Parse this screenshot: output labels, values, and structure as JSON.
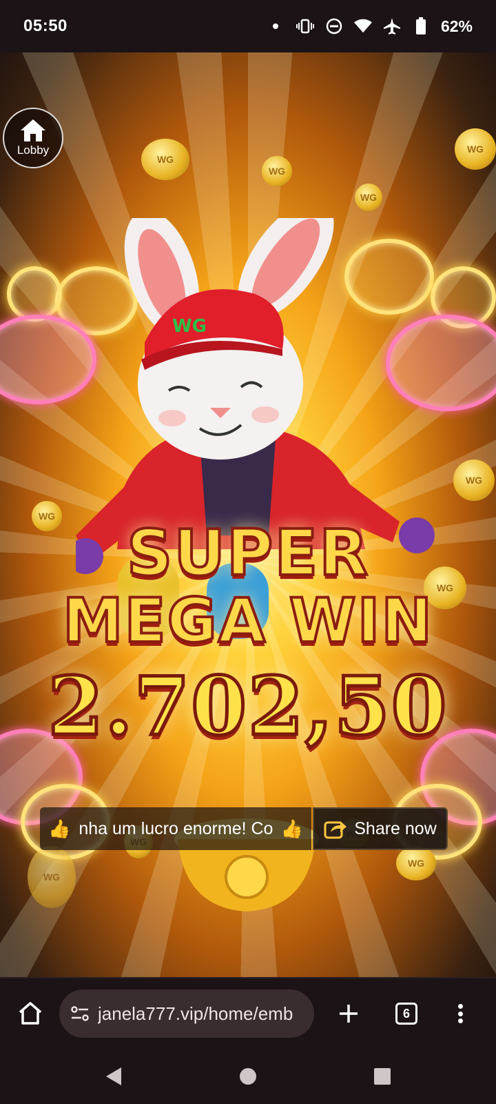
{
  "status_bar": {
    "time": "05:50",
    "battery": "62%",
    "icons": [
      "notification-dot-icon",
      "vibrate-icon",
      "do-not-disturb-icon",
      "wifi-icon",
      "airplane-icon",
      "battery-icon"
    ]
  },
  "game": {
    "lobby_label": "Lobby",
    "cap_logo": "WG",
    "win_line1": "SUPER",
    "win_line2": "MEGA WIN",
    "win_amount": "2.702,50",
    "ticker_text": "nha um lucro enorme! Cor",
    "share_label": "Share now",
    "coin_text": "WG"
  },
  "browser": {
    "url": "janela777.vip/home/emb",
    "tab_count": "6"
  },
  "colors": {
    "win_text": "#ffd84a",
    "win_stroke": "#8a1d10",
    "accent_gold": "#ffc640",
    "pink_cloud": "#ff7fb9"
  }
}
